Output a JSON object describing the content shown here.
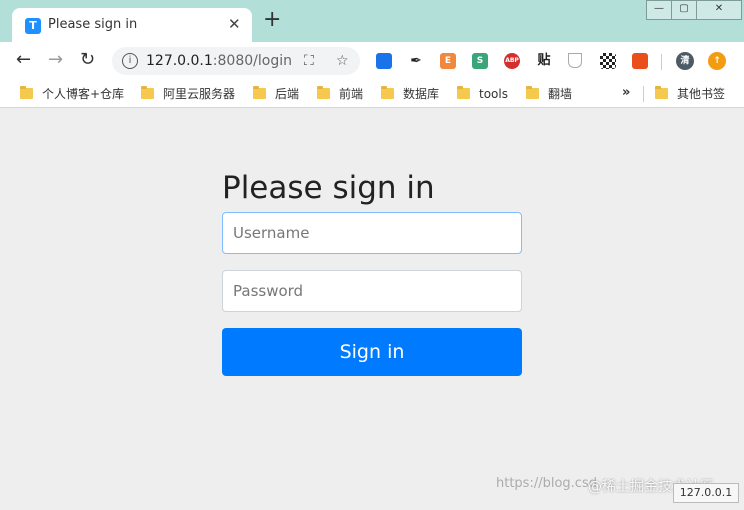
{
  "window": {
    "tab_title": "Please sign in",
    "tab_favicon": "T",
    "tab_close": "✕",
    "new_tab": "+",
    "controls": {
      "minimize": "—",
      "maximize": "▢",
      "close": "✕"
    }
  },
  "toolbar": {
    "url_host": "127.0.0.1",
    "url_path": ":8080/login",
    "extensions": [
      {
        "name": "translate-ext-icon",
        "label": "",
        "color": "#1a73e8"
      },
      {
        "name": "feather-ext-icon",
        "label": "✒",
        "color": "#222222"
      },
      {
        "name": "e-ext-icon",
        "label": "E",
        "color": "#f0883e"
      },
      {
        "name": "s-ext-icon",
        "label": "S",
        "color": "#3aa57a"
      },
      {
        "name": "abp-ext-icon",
        "label": "ABP",
        "color": "#d32f2f"
      },
      {
        "name": "tie-ext-icon",
        "label": "贴",
        "color": "#ffffff"
      },
      {
        "name": "shield-ext-icon",
        "label": "",
        "color": "#bbbbbb"
      },
      {
        "name": "qr-ext-icon",
        "label": "",
        "color": "#333333"
      },
      {
        "name": "pdf-ext-icon",
        "label": "",
        "color": "#e94e1b"
      },
      {
        "name": "profile-avatar",
        "label": "清",
        "color": "#4d5b66"
      },
      {
        "name": "update-ext-icon",
        "label": "↑",
        "color": "#f39c12"
      }
    ]
  },
  "bookmarks": {
    "items": [
      "个人博客+仓库",
      "阿里云服务器",
      "后端",
      "前端",
      "数据库",
      "tools",
      "翻墙"
    ],
    "more": "»",
    "other": "其他书签"
  },
  "login": {
    "heading": "Please sign in",
    "username_placeholder": "Username",
    "password_placeholder": "Password",
    "submit_label": "Sign in"
  },
  "watermark": {
    "url": "https://blog.csd",
    "community": "@稀土掘金技术社区"
  },
  "status_bar": "127.0.0.1"
}
